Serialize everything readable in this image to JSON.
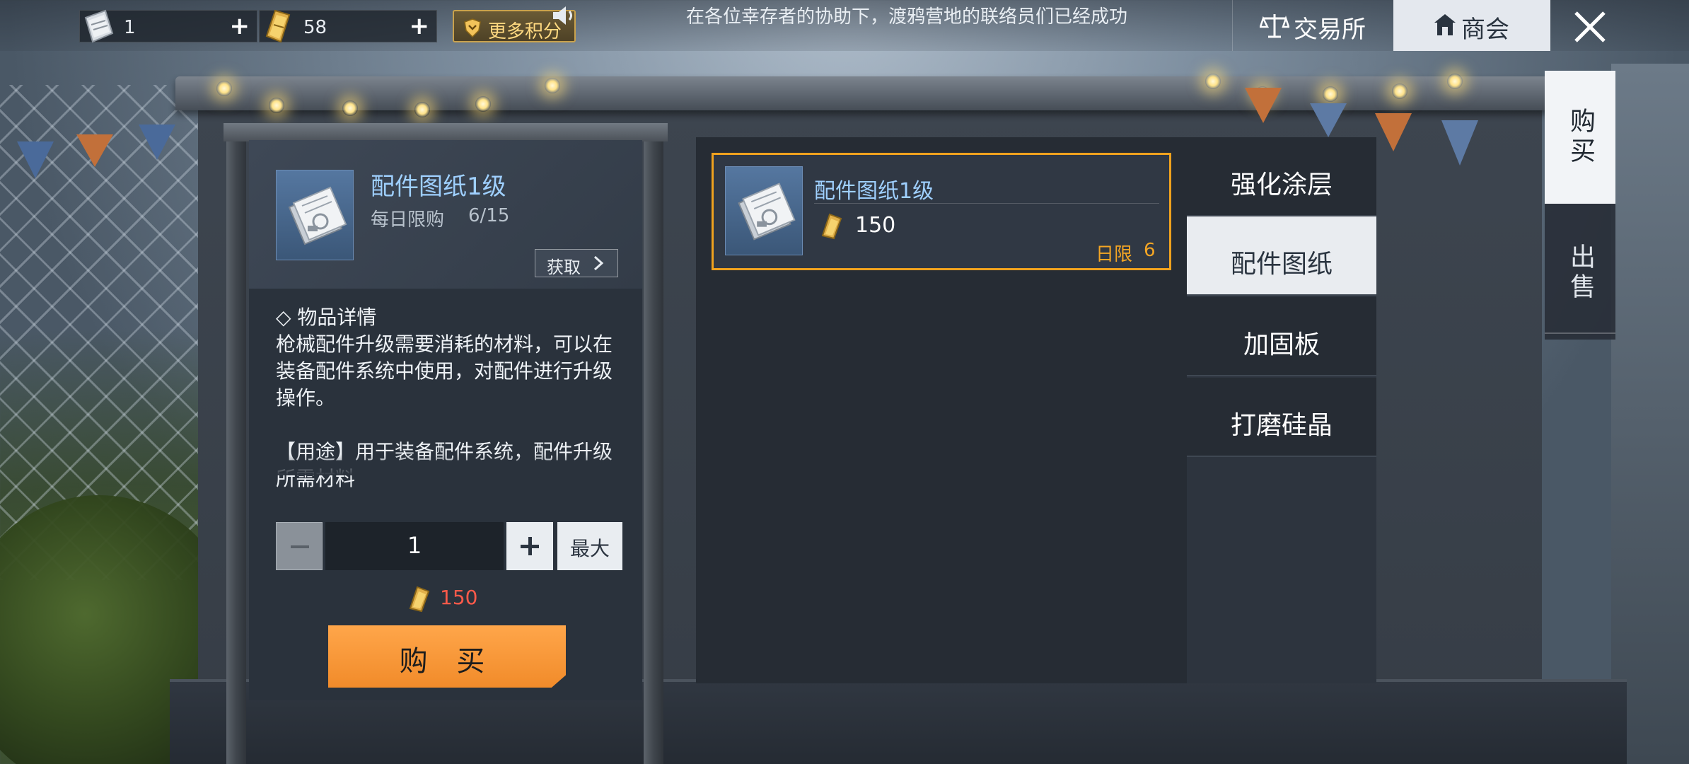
{
  "topbar": {
    "currency_1": {
      "icon": "blueprint-ticket-icon",
      "value": "1"
    },
    "currency_2": {
      "icon": "gold-ticket-icon",
      "value": "58"
    },
    "more_points_label": "更多积分",
    "marquee_text": "在各位幸存者的协助下，渡鸦营地的联络员们已经成功",
    "exchange_label": "交易所",
    "guild_label": "商会"
  },
  "side_tabs": {
    "buy_label": "购买",
    "sell_label": "出售"
  },
  "detail": {
    "item_name": "配件图纸1级",
    "limit_label": "每日限购",
    "limit_value": "6/15",
    "obtain_label": "获取",
    "desc_header": "◇ 物品详情",
    "desc_body": "枪械配件升级需要消耗的材料，可以在装备配件系统中使用，对配件进行升级操作。\n\n【用途】用于装备配件系统，配件升级所需材料",
    "quantity": "1",
    "max_label": "最大",
    "price": "150",
    "buy_label": "购 买"
  },
  "products": [
    {
      "name": "配件图纸1级",
      "price": "150",
      "limit_label": "日限",
      "limit_value": "6"
    }
  ],
  "categories": [
    {
      "label": "强化涂层"
    },
    {
      "label": "配件图纸"
    },
    {
      "label": "加固板"
    },
    {
      "label": "打磨硅晶"
    }
  ],
  "colors": {
    "accent_orange": "#f18b2a",
    "selected_border": "#f0a21e",
    "price_red": "#ff5a4a",
    "item_name_blue": "#9fd0ff"
  }
}
